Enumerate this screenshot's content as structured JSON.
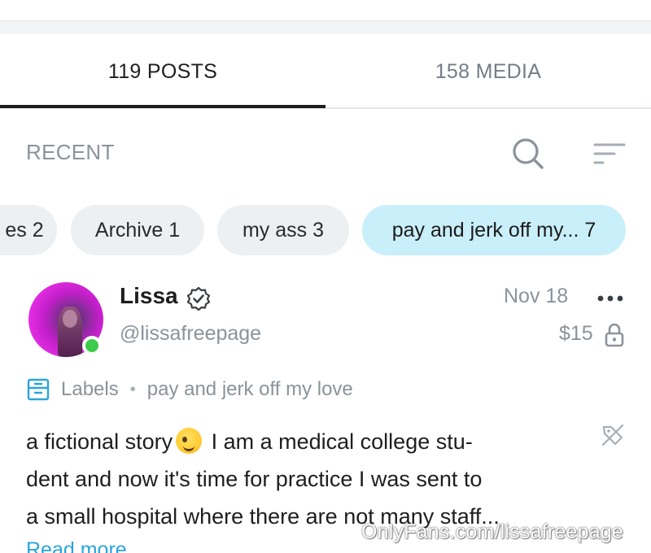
{
  "tabs": [
    {
      "label": "119 POSTS",
      "active": true
    },
    {
      "label": "158 MEDIA",
      "active": false
    }
  ],
  "feed": {
    "section_title": "RECENT",
    "search_icon": "search-icon",
    "sort_icon": "sort-icon"
  },
  "chips": [
    {
      "label": "es 2"
    },
    {
      "label": "Archive 1"
    },
    {
      "label": "my ass 3"
    },
    {
      "label": "pay and jerk off my... 7",
      "selected": true
    }
  ],
  "post": {
    "author_name": "Lissa",
    "handle": "@lissafreepage",
    "date": "Nov 18",
    "price": "$15",
    "labels_title": "Labels",
    "labels_separator": "•",
    "label_value": "pay and jerk off my love",
    "text_lines": [
      "a fictional story",
      "I am a medical college stu-",
      "dent and now it's time for practice I was sent to",
      "a small hospital where there are not many staff..."
    ],
    "read_more": "Read more",
    "online": true
  },
  "watermark": "OnlyFans.com/lissafreepage",
  "colors": {
    "accent": "#2ba4dc",
    "chip_selected": "#c9effa",
    "chip": "#edf0f2",
    "muted_text": "#8a939b",
    "online": "#3ccb4a"
  }
}
